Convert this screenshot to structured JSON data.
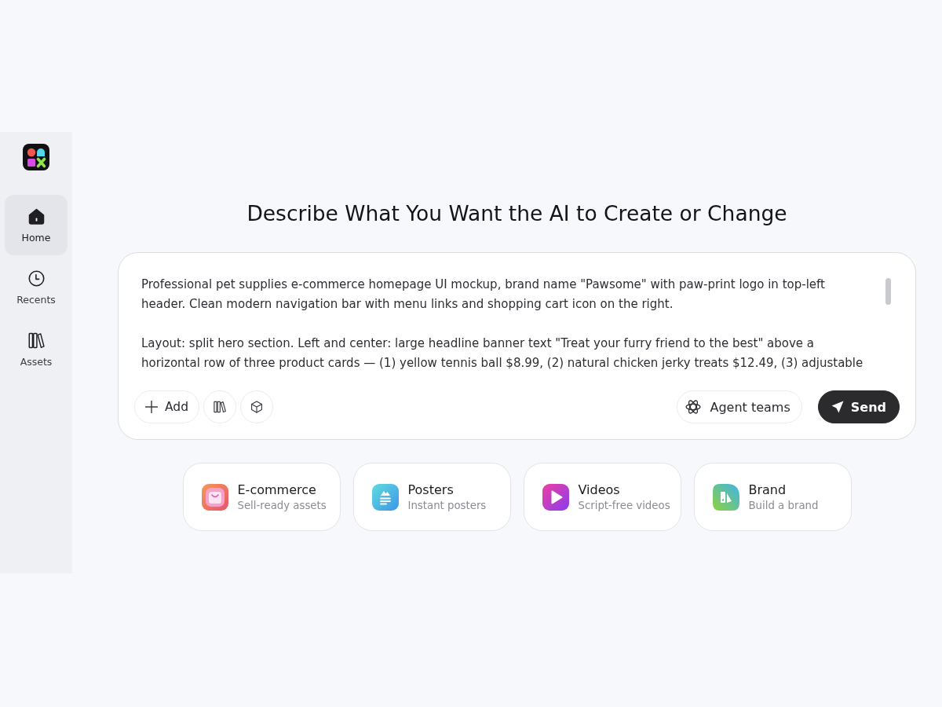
{
  "sidebar": {
    "items": [
      {
        "kind": "home",
        "label": "Home",
        "selected": true
      },
      {
        "kind": "recents",
        "label": "Recents",
        "selected": false
      },
      {
        "kind": "assets",
        "label": "Assets",
        "selected": false
      }
    ]
  },
  "heading": "Describe What You Want the AI to Create or Change",
  "prompt": {
    "value": "Professional pet supplies e-commerce homepage UI mockup, brand name \"Pawsome\" with paw-print logo in top-left header. Clean modern navigation bar with menu links and shopping cart icon on the right.\n\nLayout: split hero section. Left and center: large headline banner text \"Treat your furry friend to the best\" above a horizontal row of three product cards — (1) yellow tennis ball $8.99, (2) natural chicken jerky treats $12.49, (3) adjustable",
    "left_tools": [
      {
        "kind": "add",
        "label": "Add"
      },
      {
        "kind": "library"
      },
      {
        "kind": "cube"
      }
    ],
    "right_tools": [
      {
        "kind": "agents",
        "label": "Agent teams"
      },
      {
        "kind": "send",
        "label": "Send"
      }
    ]
  },
  "quick_starts": [
    {
      "kind": "ecommerce",
      "title": "E-commerce",
      "subtitle": "Sell-ready assets"
    },
    {
      "kind": "posters",
      "title": "Posters",
      "subtitle": "Instant posters"
    },
    {
      "kind": "videos",
      "title": "Videos",
      "subtitle": "Script-free videos"
    },
    {
      "kind": "brand",
      "title": "Brand",
      "subtitle": "Build a brand"
    }
  ]
}
